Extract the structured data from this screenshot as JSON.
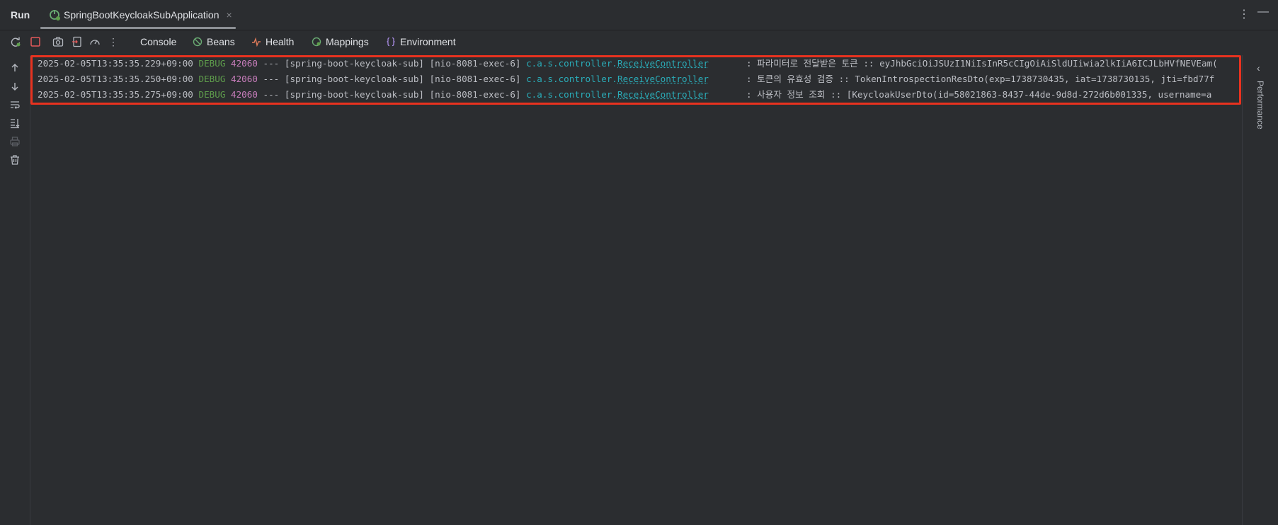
{
  "titlebar": {
    "run_label": "Run",
    "tab_label": "SpringBootKeycloakSubApplication",
    "tab_close": "×",
    "more_icon": "⋮",
    "minimize_icon": "—"
  },
  "toolbar": {
    "more_icon": "⋮",
    "console_label": "Console",
    "beans_label": "Beans",
    "health_label": "Health",
    "mappings_label": "Mappings",
    "environment_label": "Environment"
  },
  "log": [
    {
      "timestamp": "2025-02-05T13:35:35.229+09:00",
      "level": "DEBUG",
      "pid": "42060",
      "sep": "---",
      "app": "[spring-boot-keycloak-sub]",
      "thread": "[nio-8081-exec-6]",
      "pkg": "c.a.s.controller.",
      "cls": "ReceiveController",
      "message": ": 파라미터로 전달받은 토큰 :: eyJhbGciOiJSUzI1NiIsInR5cCIgOiAiSldUIiwia2lkIiA6ICJLbHVfNEVEam("
    },
    {
      "timestamp": "2025-02-05T13:35:35.250+09:00",
      "level": "DEBUG",
      "pid": "42060",
      "sep": "---",
      "app": "[spring-boot-keycloak-sub]",
      "thread": "[nio-8081-exec-6]",
      "pkg": "c.a.s.controller.",
      "cls": "ReceiveController",
      "message": ": 토큰의 유효성 검증 :: TokenIntrospectionResDto(exp=1738730435, iat=1738730135, jti=fbd77f"
    },
    {
      "timestamp": "2025-02-05T13:35:35.275+09:00",
      "level": "DEBUG",
      "pid": "42060",
      "sep": "---",
      "app": "[spring-boot-keycloak-sub]",
      "thread": "[nio-8081-exec-6]",
      "pkg": "c.a.s.controller.",
      "cls": "ReceiveController",
      "message": ": 사용자 정보 조회 :: [KeycloakUserDto(id=58021863-8437-44de-9d8d-272d6b001335, username=a"
    }
  ],
  "rightbar": {
    "chevron": "‹",
    "label": "Performance"
  },
  "colors": {
    "highlight": "#e8321f",
    "debug": "#5f9e4c",
    "pid": "#c77dbb",
    "logger": "#2aacb8"
  }
}
